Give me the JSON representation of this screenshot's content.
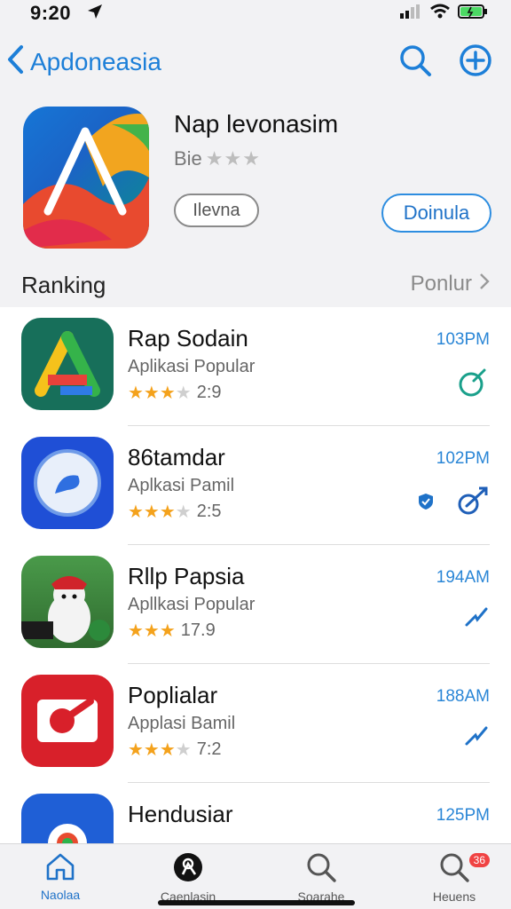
{
  "status_bar": {
    "time": "9:20"
  },
  "nav": {
    "back_label": "Apdoneasia"
  },
  "featured": {
    "title": "Nap levonasim",
    "subtitle": "Bie",
    "stars": "★★★",
    "secondary_button": "Ilevna",
    "primary_button": "Doinula"
  },
  "section": {
    "label": "Ranking",
    "link": "Ponlur"
  },
  "apps": [
    {
      "name": "Rap Sodain",
      "category": "Aplikasi Popular",
      "stars": "★★★",
      "half_star": "★",
      "rating": "2:9",
      "time": "103PM",
      "action_icon": "bell-icon"
    },
    {
      "name": "86tamdar",
      "category": "Aplkasi Pamil",
      "stars": "★★★",
      "half_star": "★",
      "rating": "2:5",
      "time": "102PM",
      "action_icon": "share-icon"
    },
    {
      "name": "Rllp Papsia",
      "category": "Apllkasi Popular",
      "stars": "★★★",
      "half_star": "",
      "rating": "17.9",
      "time": "194AM",
      "action_icon": "trend-icon"
    },
    {
      "name": "Poplialar",
      "category": "Applasi Bamil",
      "stars": "★★★",
      "half_star": "★",
      "rating": "7:2",
      "time": "188AM",
      "action_icon": "trend-icon"
    },
    {
      "name": "Hendusiar",
      "category": "",
      "stars": "",
      "half_star": "",
      "rating": "",
      "time": "125PM",
      "action_icon": ""
    }
  ],
  "tabs": [
    {
      "label": "Naolaa",
      "icon": "home-icon",
      "active": true
    },
    {
      "label": "Caenlasin",
      "icon": "profile-icon",
      "active": false
    },
    {
      "label": "Soarahe",
      "icon": "search-icon",
      "active": false
    },
    {
      "label": "Heuens",
      "icon": "notifications-icon",
      "active": false,
      "badge": "36"
    }
  ],
  "colors": {
    "accent": "#1f72c8",
    "star": "#f4a21c",
    "badge": "#f04343"
  }
}
